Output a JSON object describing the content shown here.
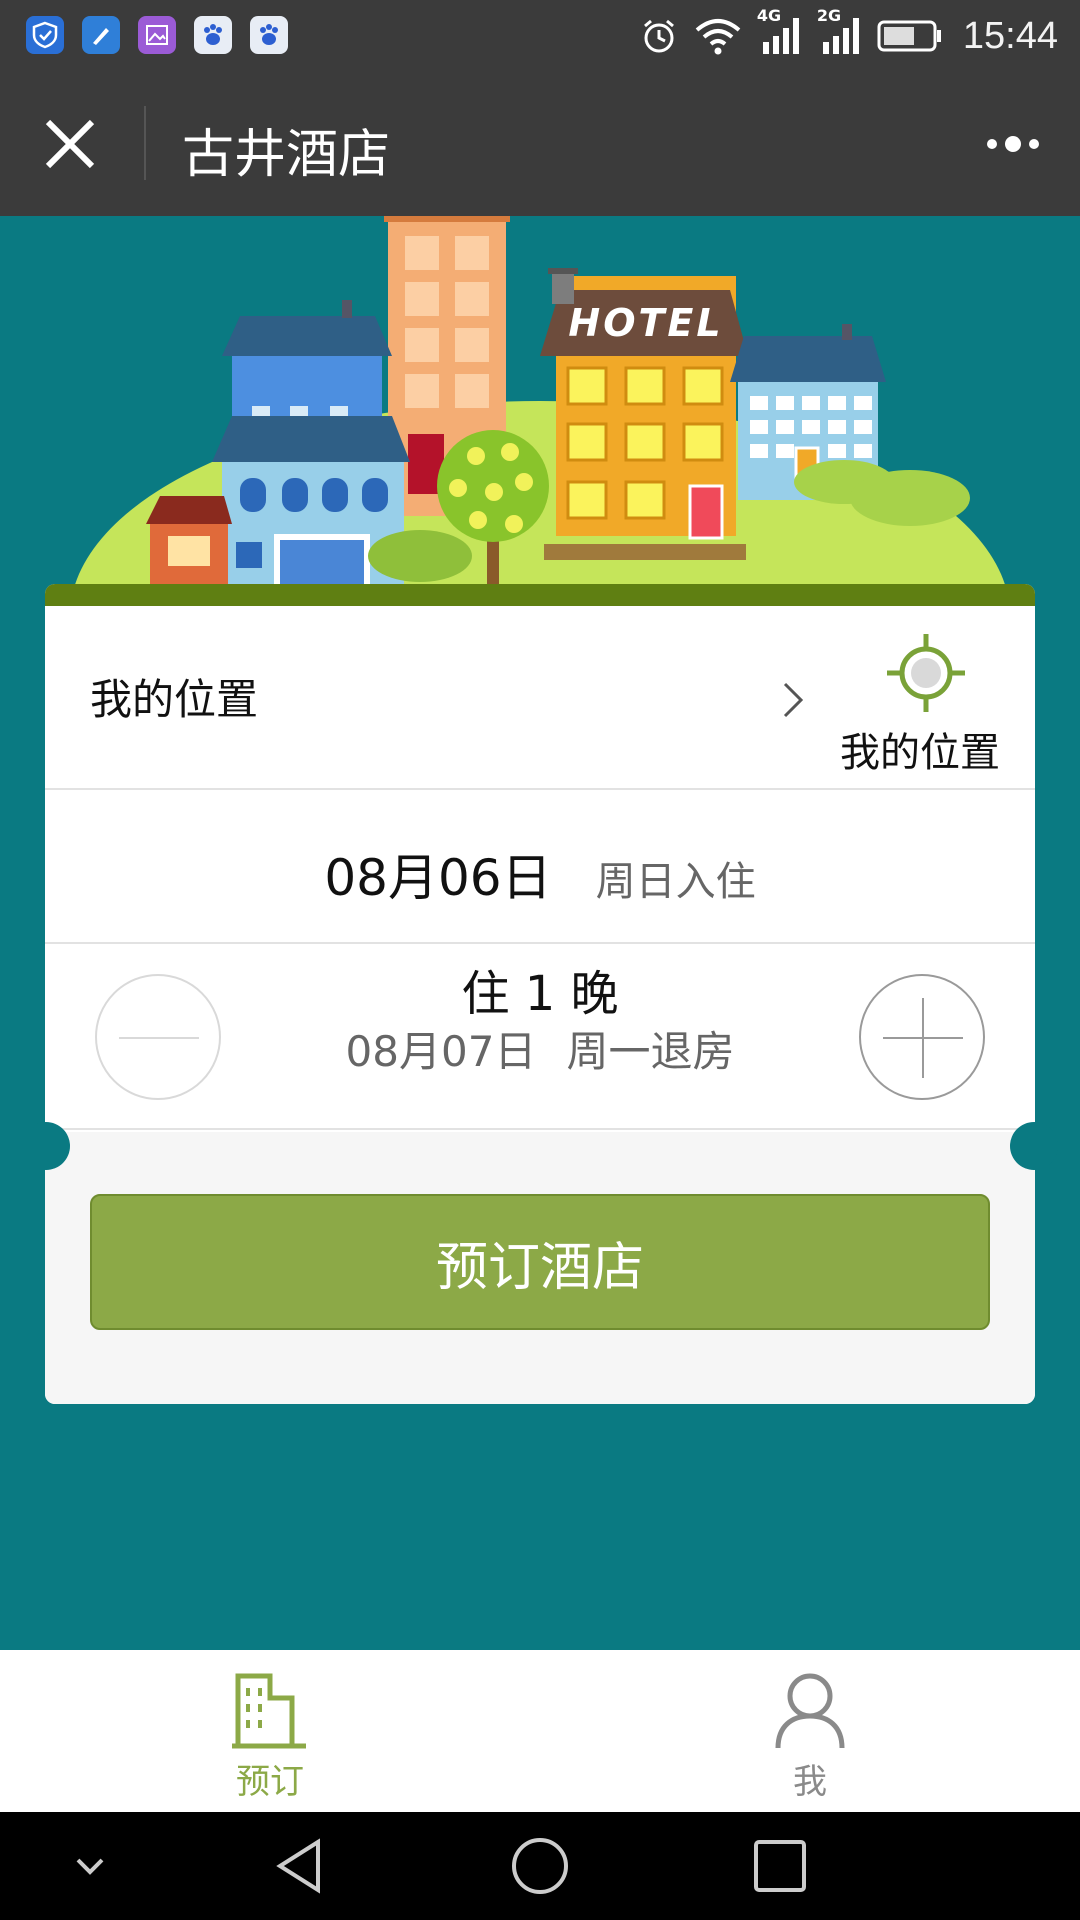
{
  "status_bar": {
    "time": "15:44",
    "network_1": "4G",
    "network_2": "2G",
    "apps": [
      "shield-app-icon",
      "brush-app-icon",
      "gallery-app-icon",
      "baidu-app-icon",
      "baidu-app-icon"
    ]
  },
  "header": {
    "title": "古井酒店",
    "close_icon": "close-icon",
    "more_icon": "more-icon"
  },
  "illustration": {
    "sign_text": "HOTEL"
  },
  "booking": {
    "location_label": "我的位置",
    "locate_button_label": "我的位置",
    "checkin_date": "08月06日",
    "checkin_label": "周日入住",
    "nights_text": "住 1 晚",
    "checkout_date": "08月07日",
    "checkout_label": "周一退房",
    "book_button": "预订酒店"
  },
  "tabs": [
    {
      "label": "预订",
      "icon": "building-icon",
      "active": true
    },
    {
      "label": "我",
      "icon": "person-icon",
      "active": false
    }
  ],
  "colors": {
    "accent": "#8ca947",
    "background": "#0a7a82",
    "header": "#3b3b3b"
  }
}
